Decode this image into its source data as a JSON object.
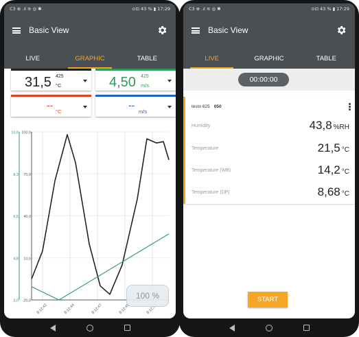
{
  "colors": {
    "appbar": "#4a4f53",
    "accent": "#f5a623",
    "left_axis": "#2e9a5c",
    "black_series": "#222222",
    "green_value": "#2e9a5c",
    "red_value": "#e04020",
    "blue_value": "#2060c0"
  },
  "status_left": {
    "left": "C3 ⊕ .ıl ≋ ◎ ✱",
    "right": "⊙⊡ 43 % ▮ 17:29"
  },
  "status_right": {
    "left": "C3 ⊕ .ıl ≋ ◎ ✱",
    "right": "⊙⊡ 43 % ▮ 17:29"
  },
  "left": {
    "title": "Basic View",
    "tabs": [
      {
        "label": "LIVE"
      },
      {
        "label": "GRAPHIC"
      },
      {
        "label": "TABLE"
      }
    ],
    "values": [
      {
        "value": "31,5",
        "serial": "425",
        "unit": "°C"
      },
      {
        "value": "4,50",
        "serial": "425",
        "unit": "m/s"
      },
      {
        "value": "--",
        "unit": "°C"
      },
      {
        "value": "--",
        "unit": "m/s"
      }
    ],
    "zoom": "100 %"
  },
  "right": {
    "title": "Basic View",
    "tabs": [
      {
        "label": "LIVE"
      },
      {
        "label": "GRAPHIC"
      },
      {
        "label": "TABLE"
      }
    ],
    "timer": "00:00:00",
    "device": {
      "name": "testo 625",
      "serial": "050"
    },
    "rows": [
      {
        "label": "Humidity",
        "value": "43,8",
        "unit": "%RH"
      },
      {
        "label": "Temperature",
        "value": "21,5",
        "unit": "°C"
      },
      {
        "label": "Temperature (WB)",
        "value": "14,2",
        "unit": "°C"
      },
      {
        "label": "Temperature (DP)",
        "value": "8,68",
        "unit": "°C"
      }
    ],
    "start_label": "START"
  },
  "chart_data": {
    "type": "line",
    "title": "",
    "x": [
      "8:12:42",
      "8:12:44",
      "8:12:47",
      "8:12:49",
      "8:12:52"
    ],
    "axes": [
      {
        "side": "left-outer",
        "ticks": [
          "10,0",
          "8,3",
          "6,5",
          "4,8",
          "3,0"
        ],
        "ylim": [
          3.0,
          10.0
        ]
      },
      {
        "side": "left-inner",
        "ticks": [
          "100,0",
          "70,0",
          "40,0",
          "10,0",
          "-20,0"
        ],
        "ylim": [
          -20.0,
          100.0
        ]
      }
    ],
    "series": [
      {
        "color": "#222222",
        "axis": "left-inner",
        "t": [
          0,
          0.8,
          1.7,
          2.6,
          3.2,
          4.2,
          5.0,
          5.7,
          6.6,
          7.7,
          8.4,
          9.1,
          9.6,
          10.0
        ],
        "values": [
          -5,
          15,
          65,
          98,
          78,
          20,
          -10,
          -16,
          5,
          52,
          95,
          92,
          93,
          80
        ]
      },
      {
        "color": "#2e9a5c",
        "axis": "left-outer",
        "t": [
          0,
          2.0,
          10.0
        ],
        "values": [
          3.55,
          3.0,
          5.75
        ]
      }
    ]
  }
}
